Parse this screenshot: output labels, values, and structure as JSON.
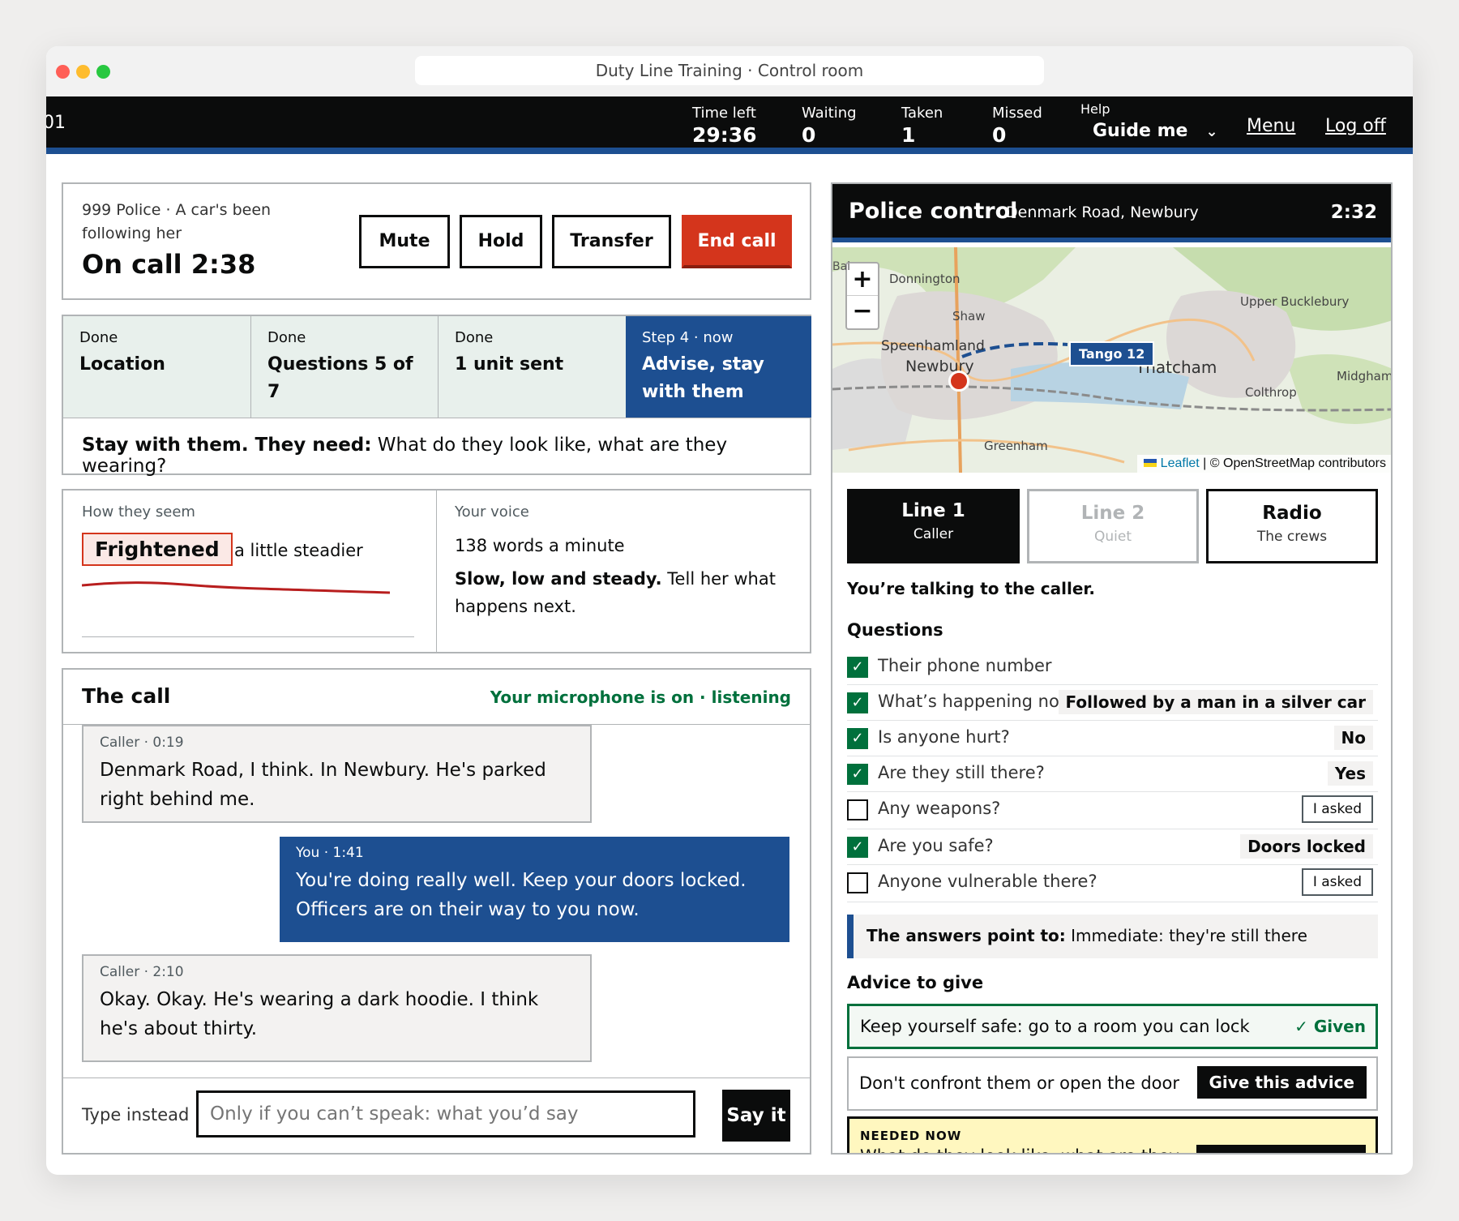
{
  "window": {
    "address": "Duty Line Training · Control room"
  },
  "topbar": {
    "left_fragment": "01",
    "time_left": {
      "label": "Time left",
      "value": "29:36"
    },
    "waiting": {
      "label": "Waiting",
      "value": "0"
    },
    "taken": {
      "label": "Taken",
      "value": "1"
    },
    "missed": {
      "label": "Missed",
      "value": "0"
    },
    "help": {
      "label": "Help",
      "value": "Guide me"
    },
    "menu": "Menu",
    "logoff": "Log off"
  },
  "call": {
    "context": "999 Police · A car's been following her",
    "status": "On call 2:38",
    "buttons": {
      "mute": "Mute",
      "hold": "Hold",
      "transfer": "Transfer",
      "end": "End call"
    }
  },
  "steps": [
    {
      "state": "Done",
      "title": "Location"
    },
    {
      "state": "Done",
      "title": "Questions 5 of 7"
    },
    {
      "state": "Done",
      "title": "1 unit sent"
    },
    {
      "state": "Step 4 · now",
      "title": "Advise, stay with them"
    }
  ],
  "instruction": {
    "bold": "Stay with them. They need:",
    "text": " What do they look like, what are they wearing?"
  },
  "mood": {
    "label": "How they seem",
    "value": "Frightened",
    "trend": "a little steadier"
  },
  "voice": {
    "label": "Your voice",
    "rate": "138 words a minute",
    "bold": "Slow, low and steady.",
    "text": " Tell her what happens next."
  },
  "transcript": {
    "title": "The call",
    "mic": "Your microphone is on · listening",
    "messages": [
      {
        "meta": "Caller · 0:19",
        "text": "Denmark Road, I think. In Newbury. He's parked right behind me."
      },
      {
        "meta": "You · 1:41",
        "text": "You're doing really well. Keep your doors locked. Officers are on their way to you now."
      },
      {
        "meta": "Caller · 2:10",
        "text": "Okay. Okay. He's wearing a dark hoodie. I think he's about thirty."
      }
    ],
    "type_label": "Type instead",
    "input_placeholder": "Only if you can’t speak: what you’d say",
    "send": "Say it"
  },
  "control": {
    "title": "Police control",
    "location": "Denmark Road, Newbury",
    "time": "2:32",
    "map": {
      "places": [
        "Donnington",
        "Shaw",
        "Speenhamland",
        "Newbury",
        "Thatcham",
        "Upper Bucklebury",
        "Midgham",
        "Colthrop",
        "Greenham",
        "Bai"
      ],
      "unit": "Tango 12",
      "zoom_in": "+",
      "zoom_out": "−",
      "attr_leaflet": "Leaflet",
      "attr_osm": "| © OpenStreetMap contributors"
    },
    "tabs": [
      {
        "label": "Line 1",
        "sub": "Caller"
      },
      {
        "label": "Line 2",
        "sub": "Quiet"
      },
      {
        "label": "Radio",
        "sub": "The crews"
      }
    ],
    "talking": "You’re talking to the caller.",
    "questions_title": "Questions",
    "questions": [
      {
        "q": "Their phone number",
        "a": "",
        "checked": true
      },
      {
        "q": "What’s happening now",
        "a": "Followed by a man in a silver car",
        "checked": true
      },
      {
        "q": "Is anyone hurt?",
        "a": "No",
        "checked": true
      },
      {
        "q": "Are they still there?",
        "a": "Yes",
        "checked": true
      },
      {
        "q": "Any weapons?",
        "a": "I asked",
        "checked": false
      },
      {
        "q": "Are you safe?",
        "a": "Doors locked",
        "checked": true
      },
      {
        "q": "Anyone vulnerable there?",
        "a": "I asked",
        "checked": false
      }
    ],
    "answers": {
      "bold": "The answers point to:",
      "text": " Immediate: they're still there"
    },
    "advice_title": "Advice to give",
    "advice": [
      {
        "text": "Keep yourself safe: go to a room you can lock",
        "status": "✓ Given"
      },
      {
        "text": "Don't confront them or open the door",
        "button": "Give this advice"
      },
      {
        "tag": "NEEDED NOW",
        "text": "What do they look like, what are they",
        "button": "Give this advice"
      }
    ]
  },
  "colors": {
    "accent": "#1d4f91",
    "danger": "#d4351c",
    "done_bg": "#e8f0ec",
    "green": "#00703c",
    "needed": "#fff7bf"
  }
}
